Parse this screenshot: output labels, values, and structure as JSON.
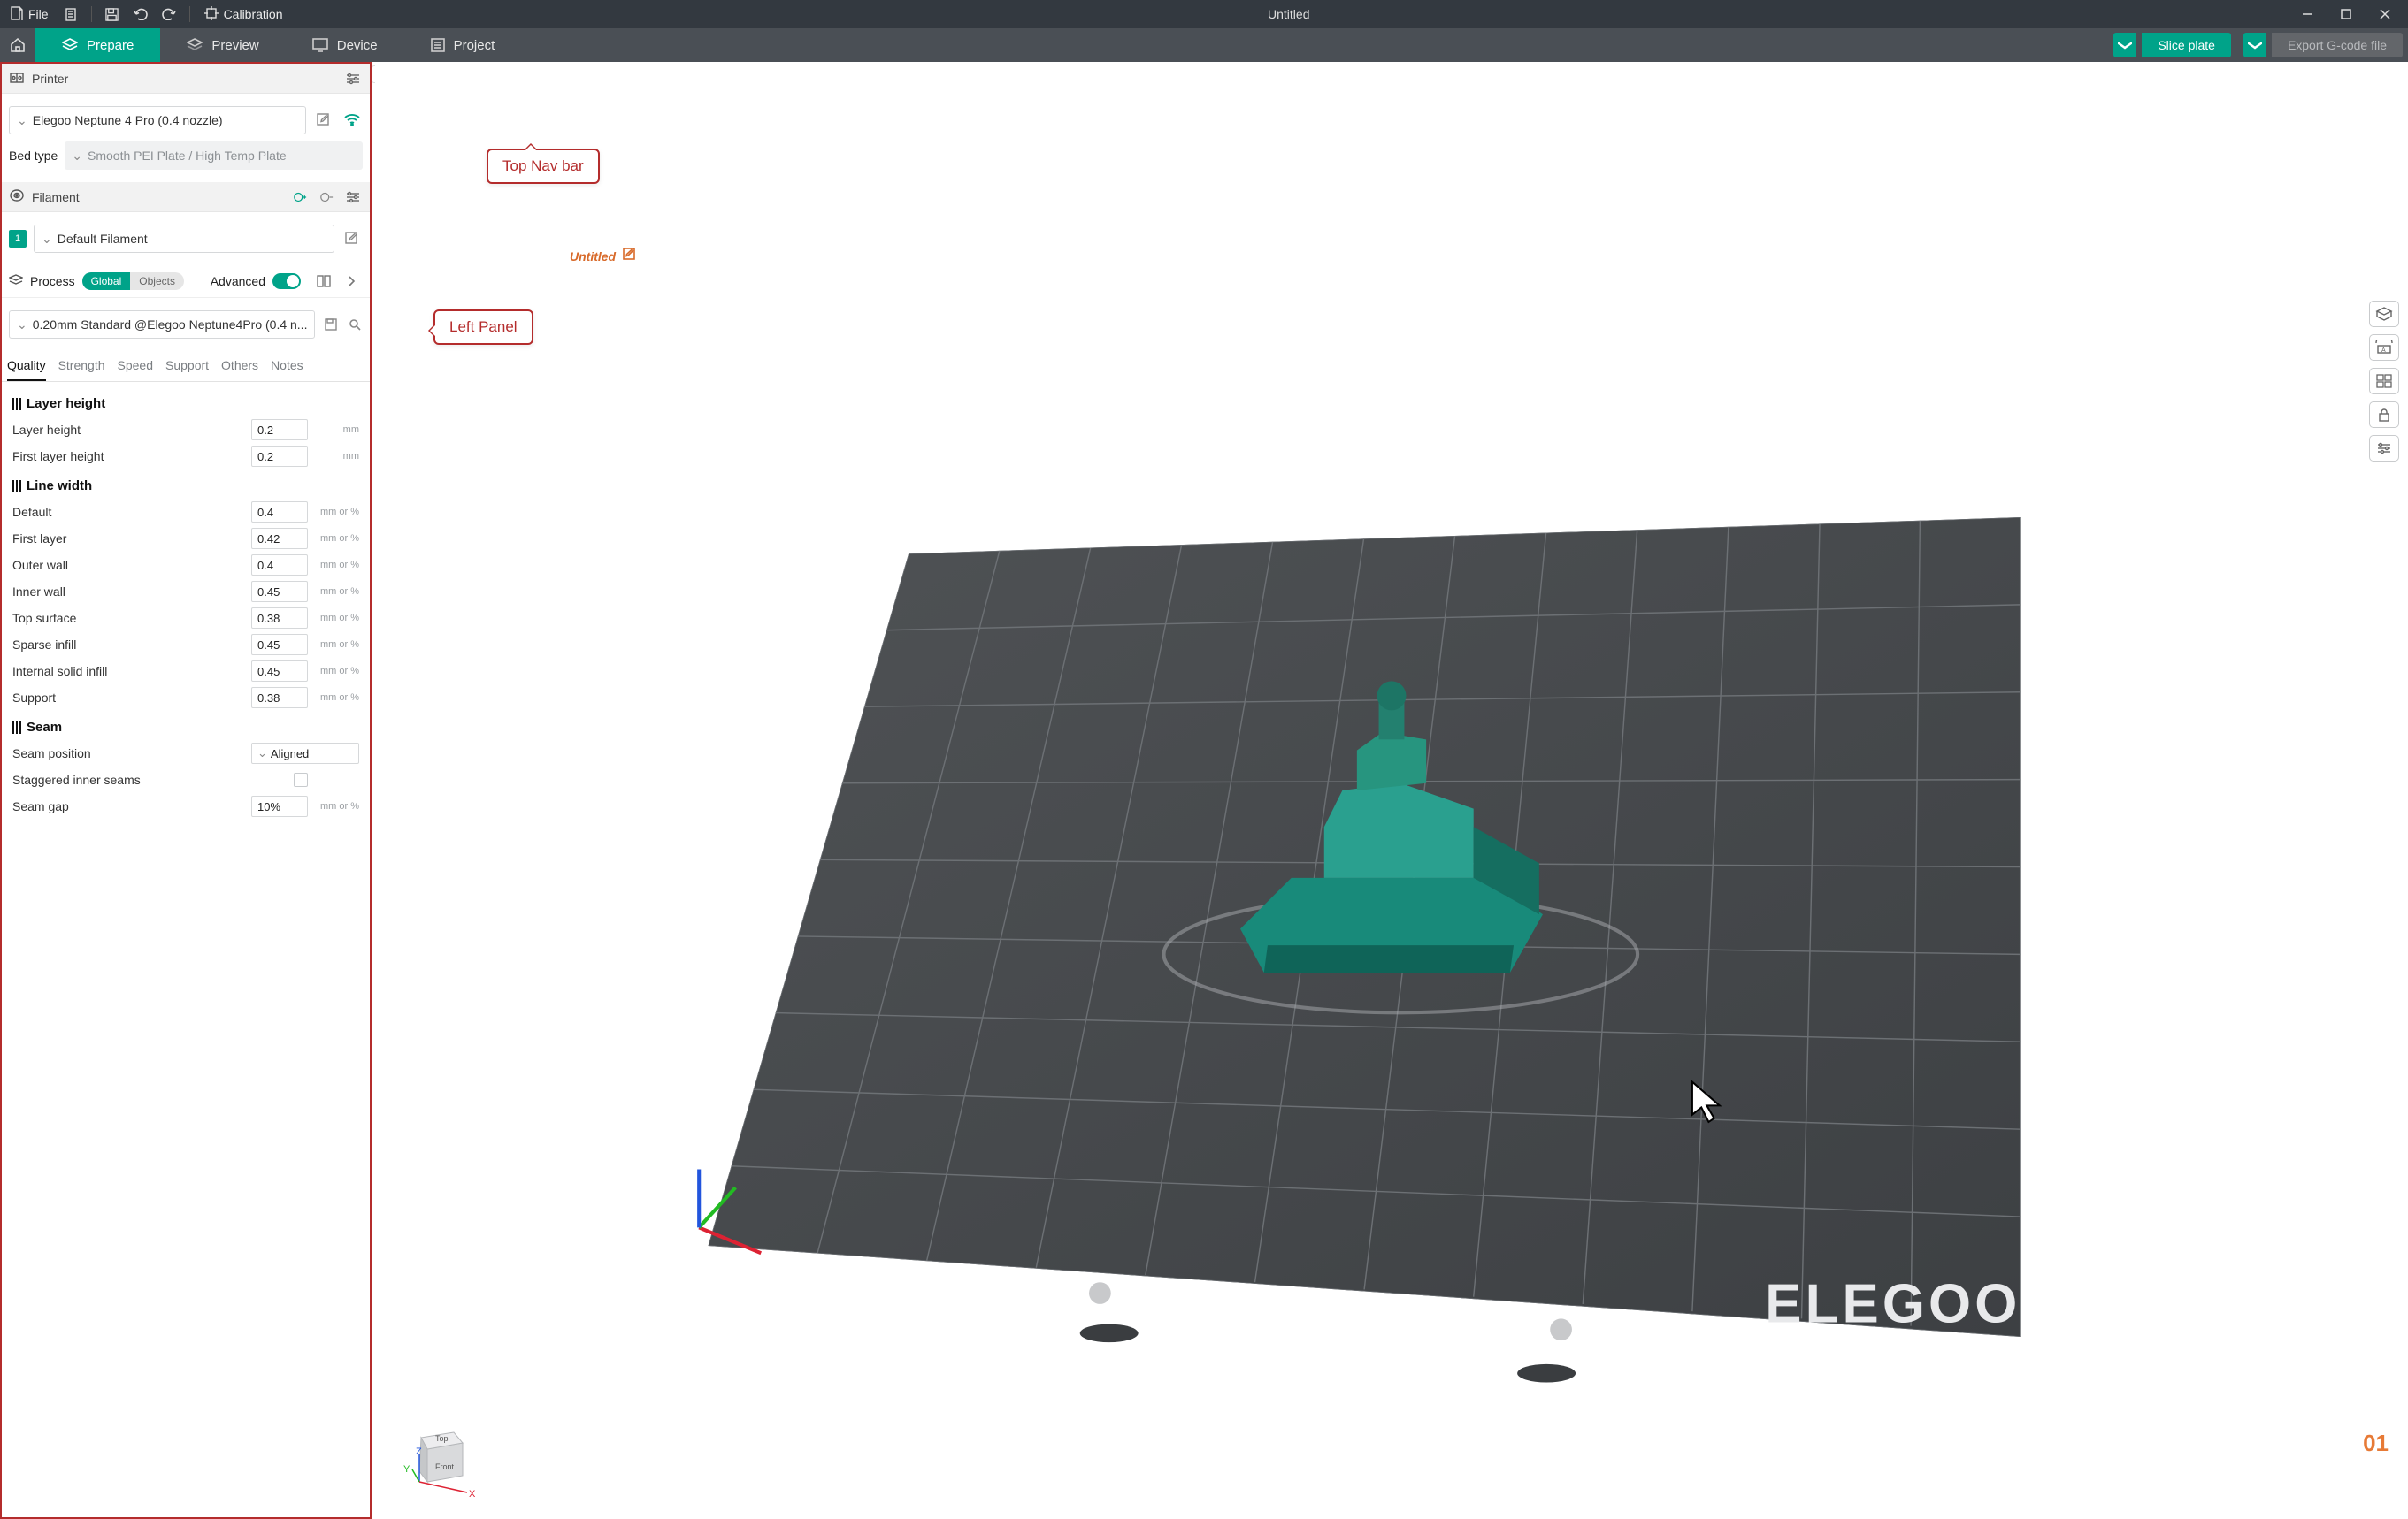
{
  "titlebar": {
    "file_label": "File",
    "calibration_label": "Calibration",
    "window_title": "Untitled"
  },
  "tabs": {
    "prepare": "Prepare",
    "preview": "Preview",
    "device": "Device",
    "project": "Project",
    "slice_label": "Slice plate",
    "export_label": "Export G-code file"
  },
  "left_panel": {
    "printer_header": "Printer",
    "printer_selected": "Elegoo Neptune 4 Pro (0.4 nozzle)",
    "bed_type_label": "Bed type",
    "bed_type_value": "Smooth PEI Plate / High Temp Plate",
    "filament_header": "Filament",
    "filament_chip": "1",
    "filament_selected": "Default Filament",
    "process_header": "Process",
    "pill_global": "Global",
    "pill_objects": "Objects",
    "advanced_label": "Advanced",
    "process_selected": "0.20mm Standard @Elegoo Neptune4Pro (0.4 n...",
    "tabs": {
      "quality": "Quality",
      "strength": "Strength",
      "speed": "Speed",
      "support": "Support",
      "others": "Others",
      "notes": "Notes"
    },
    "groups": [
      {
        "title": "Layer height",
        "rows": [
          {
            "label": "Layer height",
            "value": "0.2",
            "unit": "mm",
            "type": "num"
          },
          {
            "label": "First layer height",
            "value": "0.2",
            "unit": "mm",
            "type": "num"
          }
        ]
      },
      {
        "title": "Line width",
        "rows": [
          {
            "label": "Default",
            "value": "0.4",
            "unit": "mm or %",
            "type": "num"
          },
          {
            "label": "First layer",
            "value": "0.42",
            "unit": "mm or %",
            "type": "num"
          },
          {
            "label": "Outer wall",
            "value": "0.4",
            "unit": "mm or %",
            "type": "num"
          },
          {
            "label": "Inner wall",
            "value": "0.45",
            "unit": "mm or %",
            "type": "num"
          },
          {
            "label": "Top surface",
            "value": "0.38",
            "unit": "mm or %",
            "type": "num"
          },
          {
            "label": "Sparse infill",
            "value": "0.45",
            "unit": "mm or %",
            "type": "num"
          },
          {
            "label": "Internal solid infill",
            "value": "0.45",
            "unit": "mm or %",
            "type": "num"
          },
          {
            "label": "Support",
            "value": "0.38",
            "unit": "mm or %",
            "type": "num"
          }
        ]
      },
      {
        "title": "Seam",
        "rows": [
          {
            "label": "Seam position",
            "value": "Aligned",
            "type": "sel"
          },
          {
            "label": "Staggered inner seams",
            "type": "chk"
          },
          {
            "label": "Seam gap",
            "value": "10%",
            "unit": "mm or %",
            "type": "num"
          }
        ]
      }
    ]
  },
  "viewport": {
    "plate_title": "Untitled",
    "plate_number": "01",
    "brand": "ELEGOO",
    "cube_top": "Top",
    "cube_front": "Front",
    "axis_x": "X",
    "axis_y": "Y",
    "axis_z": "Z"
  },
  "annotations": {
    "top_nav": "Top Nav bar",
    "left_panel": "Left Panel"
  },
  "icons": {
    "new_doc": "document-plus-icon",
    "clipboard": "clipboard-icon",
    "save": "save-icon",
    "undo": "undo-icon",
    "redo": "redo-icon",
    "calib": "calibration-target-icon",
    "home": "home-icon",
    "prepare": "layers-icon",
    "preview": "layers-outline-icon",
    "device": "monitor-icon",
    "project": "list-icon",
    "slice_dd": "chevron-down-icon",
    "export_dd": "chevron-down-icon"
  },
  "colors": {
    "accent": "#00a389",
    "titlebar": "#333940",
    "tabbar": "#4a4f55",
    "annotation": "#b42c2c",
    "plate_orange": "#e77a36"
  }
}
